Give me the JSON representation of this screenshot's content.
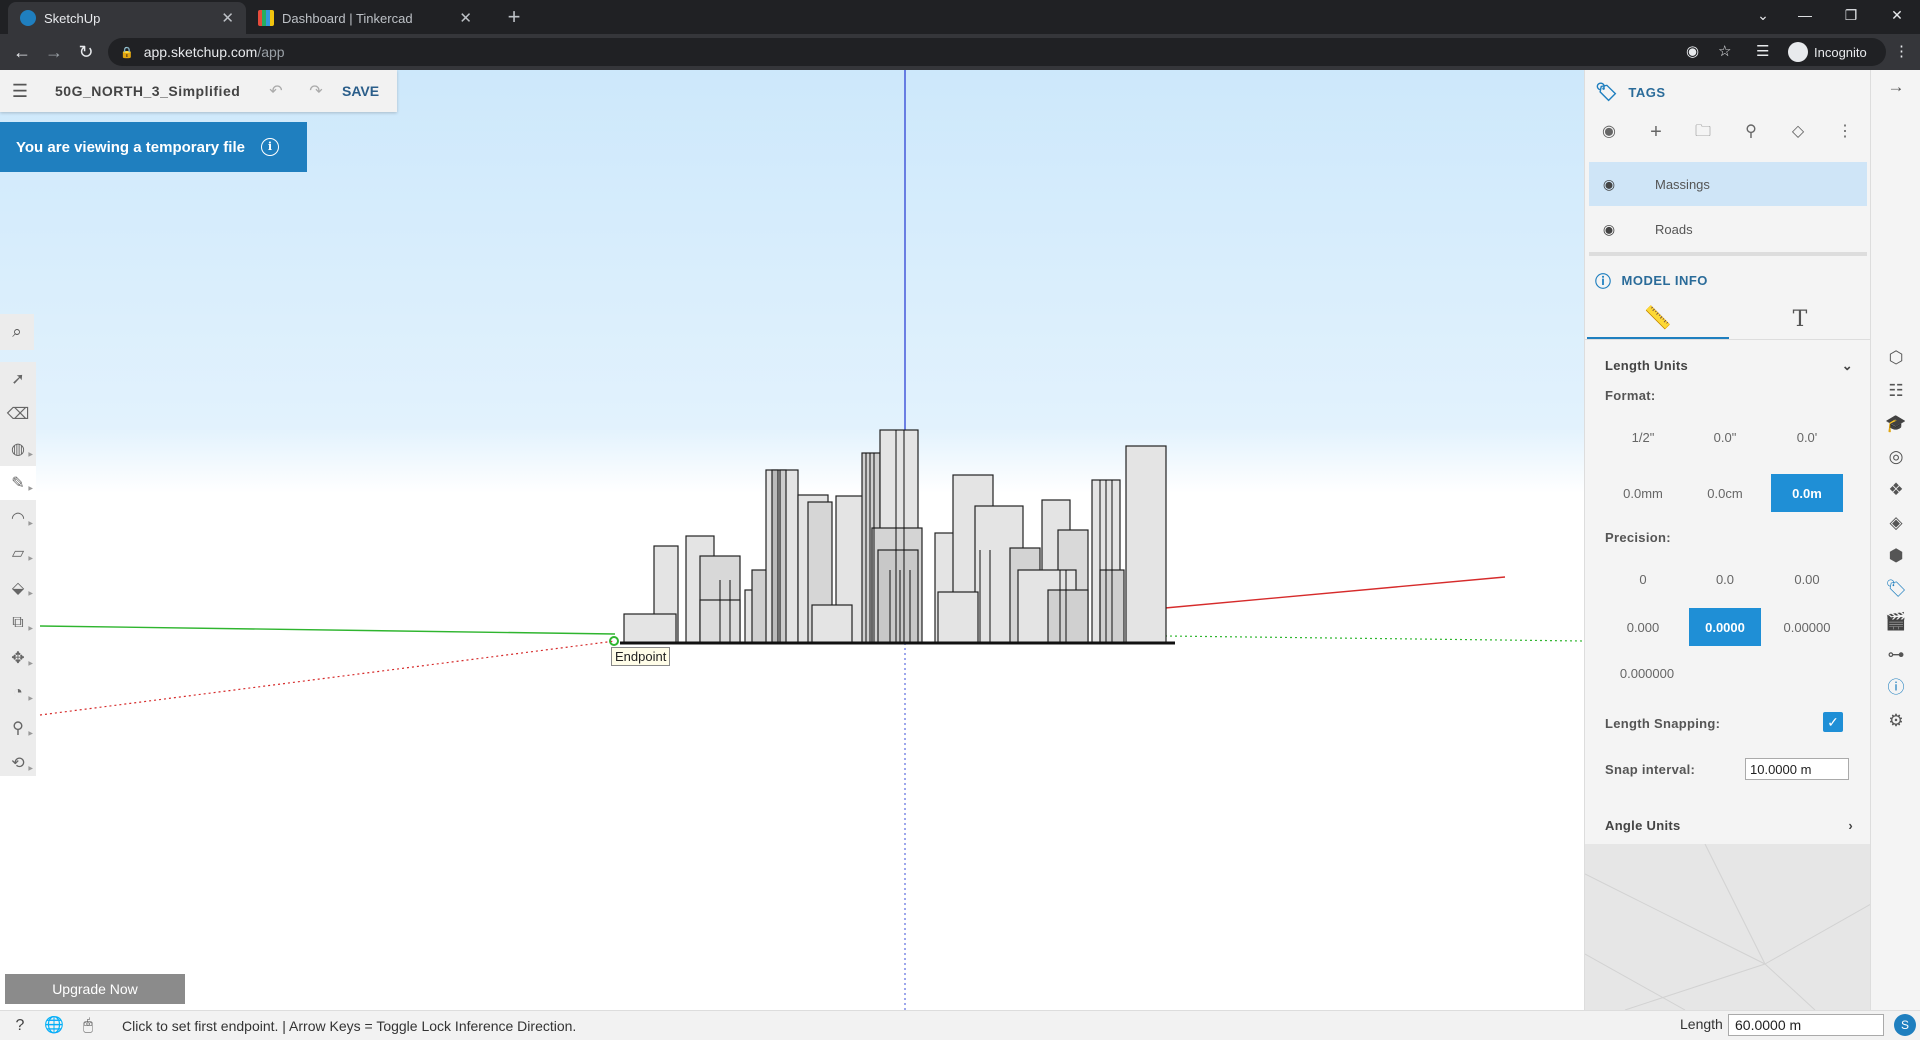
{
  "browser": {
    "tabs": [
      {
        "title": "SketchUp",
        "active": true
      },
      {
        "title": "Dashboard | Tinkercad",
        "active": false
      }
    ],
    "url_host": "app.sketchup.com",
    "url_path": "/app",
    "profile": "Incognito"
  },
  "header": {
    "file_name": "50G_NORTH_3_Simplified",
    "save_label": "SAVE"
  },
  "banner": {
    "text": "You are viewing a temporary file"
  },
  "viewport": {
    "tooltip": "Endpoint",
    "upgrade_label": "Upgrade Now",
    "axis_colors": {
      "blue": "#3b4fd8",
      "red": "#d62b2b",
      "green": "#2fb52f"
    }
  },
  "tags": {
    "title": "TAGS",
    "items": [
      {
        "name": "Massings",
        "selected": true
      },
      {
        "name": "Roads",
        "selected": false
      }
    ]
  },
  "model_info": {
    "title": "MODEL INFO",
    "length_units": {
      "heading": "Length Units",
      "format_label": "Format:",
      "formats": [
        "1/2\"",
        "0.0\"",
        "0.0'",
        "0.0mm",
        "0.0cm",
        "0.0m"
      ],
      "format_selected": "0.0m",
      "precision_label": "Precision:",
      "precisions": [
        "0",
        "0.0",
        "0.00",
        "0.000",
        "0.0000",
        "0.00000",
        "0.000000"
      ],
      "precision_selected": "0.0000",
      "snapping_label": "Length Snapping:",
      "snapping_enabled": true,
      "snap_interval_label": "Snap interval:",
      "snap_interval_value": "10.0000 m"
    },
    "angle_units": {
      "heading": "Angle Units"
    }
  },
  "status": {
    "message": "Click to set first endpoint. | Arrow Keys = Toggle Lock Inference Direction.",
    "length_label": "Length",
    "length_value": "60.0000 m"
  },
  "colors": {
    "accent": "#1f8fd6",
    "banner": "#1f7fbf",
    "tag_selected": "#cfe5f7"
  }
}
